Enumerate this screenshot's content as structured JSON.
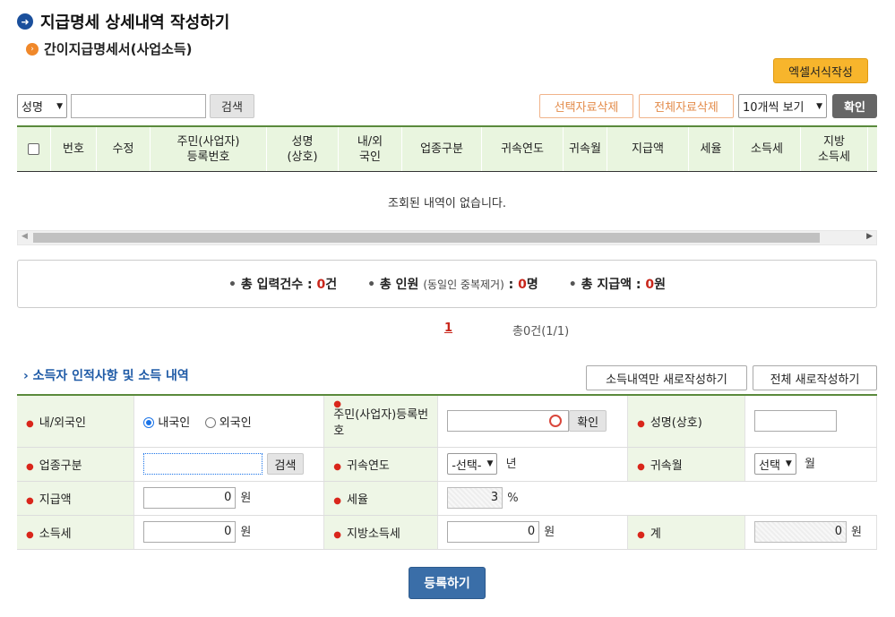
{
  "header": {
    "title": "지급명세 상세내역 작성하기",
    "subtitle": "간이지급명세서(사업소득)"
  },
  "toolbar": {
    "excel_label": "엑셀서식작성",
    "search_field_selected": "성명",
    "search_value": "",
    "search_label": "검색",
    "delete_selected_label": "선택자료삭제",
    "delete_all_label": "전체자료삭제",
    "page_size_selected": "10개씩 보기",
    "confirm_label": "확인"
  },
  "grid": {
    "columns": [
      "번호",
      "수정",
      "주민(사업자)\n등록번호",
      "성명\n(상호)",
      "내/외\n국인",
      "업종구분",
      "귀속연도",
      "귀속월",
      "지급액",
      "세율",
      "소득세",
      "지방\n소득세"
    ],
    "empty_message": "조회된 내역이 없습니다."
  },
  "summary": {
    "total_count_label": "총 입력건수 : ",
    "total_count_value": "0",
    "total_count_unit": "건",
    "total_people_label": "총 인원 ",
    "total_people_note": "(동일인 중복제거)",
    "total_people_sep": " : ",
    "total_people_value": "0",
    "total_people_unit": "명",
    "total_pay_label": "총 지급액 : ",
    "total_pay_value": "0",
    "total_pay_unit": "원"
  },
  "pager": {
    "current": "1",
    "total_text": "총0건(1/1)"
  },
  "form": {
    "section_title": "소득자 인적사항 및 소득 내역",
    "reset_income_label": "소득내역만 새로작성하기",
    "reset_all_label": "전체 새로작성하기",
    "nationality_label": "내/외국인",
    "domestic_label": "내국인",
    "foreign_label": "외국인",
    "rrn_label": "주민(사업자)등록번호",
    "confirm_label": "확인",
    "name_label": "성명(상호)",
    "business_type_label": "업종구분",
    "search_label": "검색",
    "year_label": "귀속연도",
    "year_selected": "-선택-",
    "year_unit": "년",
    "month_label": "귀속월",
    "month_selected": "선택",
    "month_unit": "월",
    "pay_label": "지급액",
    "pay_value": "0",
    "won": "원",
    "rate_label": "세율",
    "rate_value": "3",
    "rate_unit": "%",
    "income_tax_label": "소득세",
    "income_tax_value": "0",
    "local_tax_label": "지방소득세",
    "local_tax_value": "0",
    "total_label": "계",
    "total_value": "0",
    "submit_label": "등록하기"
  },
  "colors": {
    "accent_green": "#5a8a3c",
    "header_bg": "#e9f5df",
    "highlight_red": "#c9261b",
    "brand_blue": "#1e5aa6",
    "excel_btn": "#f7b52c"
  }
}
